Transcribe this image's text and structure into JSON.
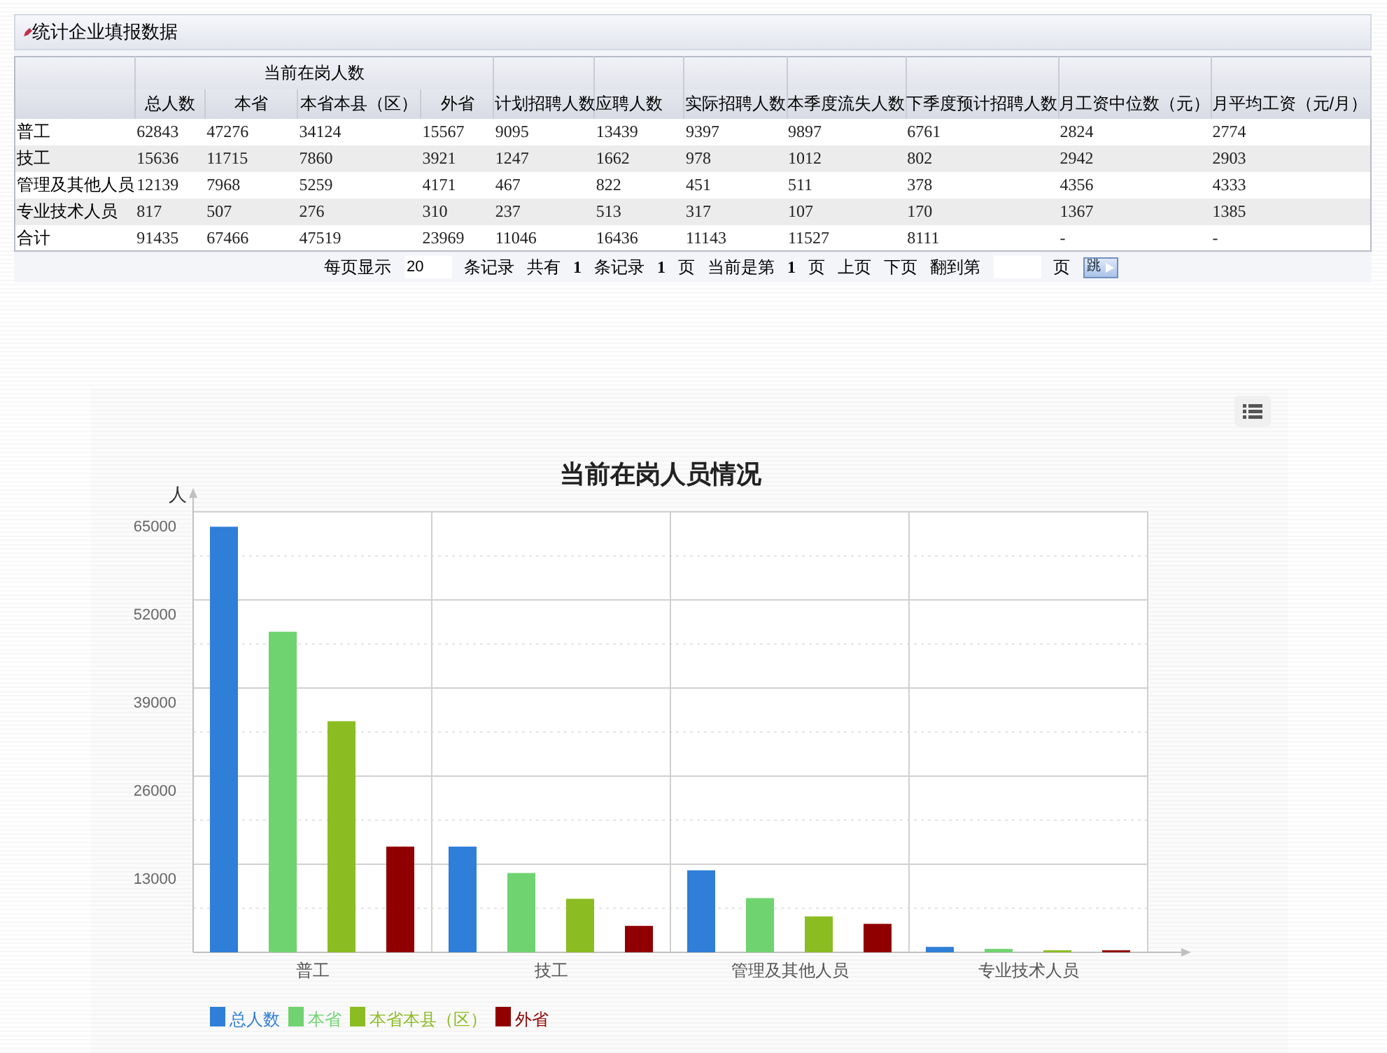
{
  "panel": {
    "title": "统计企业填报数据"
  },
  "table": {
    "group_header": "当前在岗人数",
    "columns": [
      "",
      "总人数",
      "本省",
      "本省本县（区）",
      "外省",
      "计划招聘人数",
      "应聘人数",
      "实际招聘人数",
      "本季度流失人数",
      "下季度预计招聘人数",
      "月工资中位数（元）",
      "月平均工资（元/月）"
    ],
    "rows": [
      [
        "普工",
        "62843",
        "47276",
        "34124",
        "15567",
        "9095",
        "13439",
        "9397",
        "9897",
        "6761",
        "2824",
        "2774"
      ],
      [
        "技工",
        "15636",
        "11715",
        "7860",
        "3921",
        "1247",
        "1662",
        "978",
        "1012",
        "802",
        "2942",
        "2903"
      ],
      [
        "管理及其他人员",
        "12139",
        "7968",
        "5259",
        "4171",
        "467",
        "822",
        "451",
        "511",
        "378",
        "4356",
        "4333"
      ],
      [
        "专业技术人员",
        "817",
        "507",
        "276",
        "310",
        "237",
        "513",
        "317",
        "107",
        "170",
        "1367",
        "1385"
      ],
      [
        "合计",
        "91435",
        "67466",
        "47519",
        "23969",
        "11046",
        "16436",
        "11143",
        "11527",
        "8111",
        "-",
        "-"
      ]
    ]
  },
  "pager": [
    {
      "kind": "text",
      "text": "每页显示"
    },
    {
      "kind": "input",
      "value": "20"
    },
    {
      "kind": "text",
      "text": "条记录"
    },
    {
      "kind": "text",
      "text": "共有"
    },
    {
      "kind": "bold",
      "text": "1"
    },
    {
      "kind": "text",
      "text": "条记录"
    },
    {
      "kind": "bold",
      "text": "1"
    },
    {
      "kind": "text",
      "text": "页"
    },
    {
      "kind": "text",
      "text": "当前是第"
    },
    {
      "kind": "bold",
      "text": "1"
    },
    {
      "kind": "text",
      "text": "页"
    },
    {
      "kind": "link",
      "text": "上页"
    },
    {
      "kind": "link",
      "text": "下页"
    },
    {
      "kind": "text",
      "text": "翻到第"
    },
    {
      "kind": "input"
    },
    {
      "kind": "text",
      "text": "页"
    },
    {
      "kind": "button",
      "text": "跳"
    }
  ],
  "chart_data": {
    "type": "bar",
    "title": "当前在岗人员情况",
    "ylabel": "人",
    "categories": [
      "普工",
      "技工",
      "管理及其他人员",
      "专业技术人员"
    ],
    "series": [
      {
        "name": "总人数",
        "color": "#2f7ed8",
        "values": [
          62800,
          15600,
          12100,
          800
        ]
      },
      {
        "name": "本省",
        "color": "#6fd36f",
        "values": [
          47300,
          11700,
          8000,
          500
        ]
      },
      {
        "name": "本省本县（区）",
        "color": "#8bbc21",
        "values": [
          34100,
          7900,
          5300,
          300
        ]
      },
      {
        "name": "外省",
        "color": "#910000",
        "values": [
          15600,
          3900,
          4200,
          300
        ]
      }
    ],
    "ylim": [
      0,
      65000
    ],
    "yticks": [
      13000,
      26000,
      39000,
      52000,
      65000
    ],
    "grid": true,
    "legend": true
  }
}
